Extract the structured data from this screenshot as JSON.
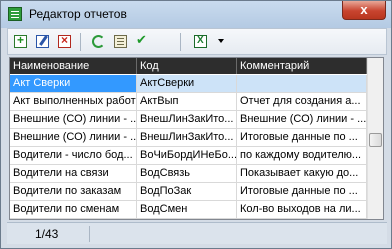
{
  "window": {
    "title": "Редактор отчетов",
    "close_label": "x"
  },
  "toolbar": {
    "buttons": [
      "add-icon",
      "edit-icon",
      "delete-icon",
      "refresh-icon",
      "properties-icon",
      "apply-icon",
      "excel-export-icon"
    ]
  },
  "grid": {
    "columns": [
      "Наименование",
      "Код",
      "Комментарий"
    ],
    "rows": [
      [
        "Акт Сверки",
        "АктСверки",
        ""
      ],
      [
        "Акт выполненных работ",
        "АктВып",
        "Отчет для создания а..."
      ],
      [
        "Внешние (СО) линии - ...",
        "ВнешЛинЗакИто...",
        "Внешние (СО) линии - ..."
      ],
      [
        "Внешние (СО) линии - ...",
        "ВнешЛинЗакИто...",
        "Итоговые данные по ..."
      ],
      [
        "Водители - число бод...",
        "ВоЧиБордИНеБо...",
        "по каждому водителю..."
      ],
      [
        "Водители на связи",
        "ВодСвязь",
        "Показывает какую до..."
      ],
      [
        "Водители по заказам",
        "ВодПоЗак",
        "Итоговые данные по ..."
      ],
      [
        "Водители по сменам",
        "ВодСмен",
        "Кол-во выходов на ли..."
      ]
    ]
  },
  "status": {
    "record_counter": "1/43"
  },
  "colors": {
    "selection": "#3399ff",
    "header_bg": "#2d2d2d"
  }
}
